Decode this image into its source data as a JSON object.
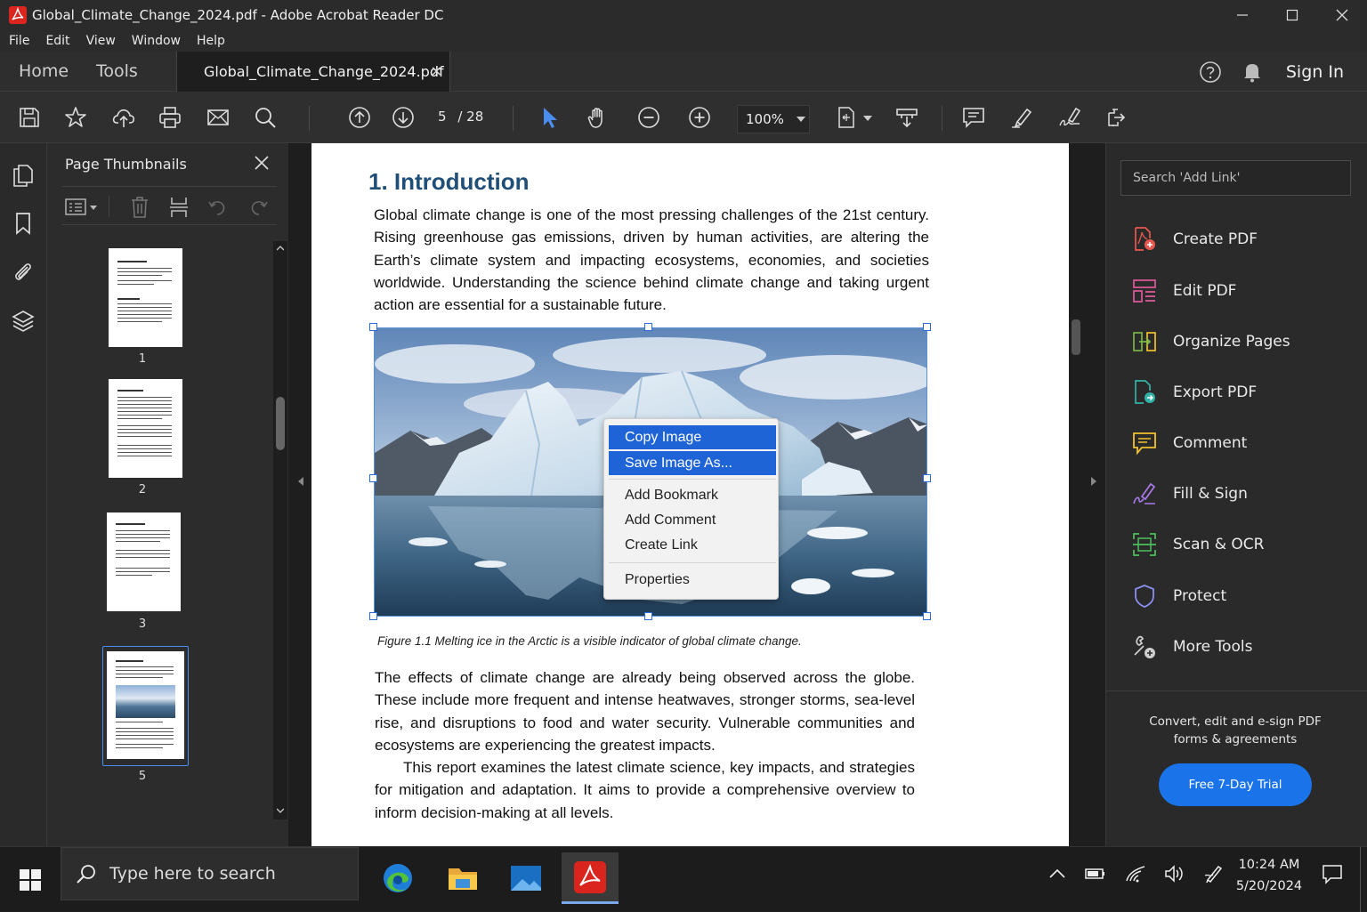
{
  "window": {
    "title": "Global_Climate_Change_2024.pdf - Adobe Acrobat Reader DC",
    "controls": [
      "minimize-icon",
      "maximize-icon",
      "close-icon"
    ]
  },
  "menu": [
    "File",
    "Edit",
    "View",
    "Window",
    "Help"
  ],
  "tabs": {
    "home": "Home",
    "tools": "Tools",
    "document": "Global_Climate_Change_2024.pdf",
    "close_glyph": "×",
    "sign_in": "Sign In"
  },
  "toolbar": {
    "current_page": "5",
    "page_total": "/ 28",
    "zoom": "100%",
    "icons": [
      "save-icon",
      "star-icon",
      "upload-icon",
      "print-icon",
      "email-icon",
      "search-icon",
      "page-up-icon",
      "page-down-icon",
      "select-cursor-icon",
      "hand-icon",
      "zoom-out-icon",
      "zoom-in-icon",
      "page-fit-icon",
      "scroll-mode-icon",
      "comment-icon",
      "highlight-icon",
      "sign-icon",
      "share-icon"
    ]
  },
  "left_rail": [
    "pages-icon",
    "bookmark-icon",
    "attachment-icon",
    "layers-icon"
  ],
  "thumbnails": {
    "title": "Page Thumbnails",
    "pages": [
      "1",
      "2",
      "3",
      "5"
    ],
    "selected_page": "5"
  },
  "document": {
    "heading": "1.  Introduction",
    "para1": "Global climate change is one of the most pressing challenges of the 21st century. Rising greenhouse gas emissions, driven by human activities, are altering the Earth’s climate system and impacting ecosystems, economies, and societies worldwide. Understanding the science behind climate change and taking urgent action are essential for a sustainable future.",
    "caption": "Figure 1.1  Melting ice in the Arctic is a visible indicator of global climate change.",
    "para2": "The effects of climate change are already being observed across the globe. These include more frequent and intense heatwaves, stronger storms, sea-level rise, and disruptions to food and water security. Vulnerable communities and ecosystems are experiencing the greatest impacts.",
    "para3": "This report examines the latest climate science, key impacts, and strategies for mitigation and adaptation. It aims to provide a comprehensive overview to inform decision-making at all levels."
  },
  "context_menu": {
    "items": [
      "Copy Image",
      "Save Image As...",
      "Add Bookmark",
      "Add Comment",
      "Create Link",
      "Properties"
    ],
    "highlighted": [
      "Copy Image",
      "Save Image As..."
    ]
  },
  "right_panel": {
    "search_placeholder": "Search 'Add Link'",
    "tools": [
      {
        "label": "Create PDF",
        "color": "#e8584f"
      },
      {
        "label": "Edit PDF",
        "color": "#e05a9c"
      },
      {
        "label": "Organize Pages",
        "color": "#7ab648"
      },
      {
        "label": "Export PDF",
        "color": "#33b3a6"
      },
      {
        "label": "Comment",
        "color": "#f2c12e"
      },
      {
        "label": "Fill & Sign",
        "color": "#a879e8"
      },
      {
        "label": "Scan & OCR",
        "color": "#4dbf5a"
      },
      {
        "label": "Protect",
        "color": "#8a8ff0"
      },
      {
        "label": "More Tools",
        "color": "#cfcfcf"
      }
    ],
    "promo": "Convert, edit and e-sign PDF forms & agreements",
    "trial_button": "Free 7-Day Trial"
  },
  "taskbar": {
    "search_placeholder": "Type here to search",
    "apps": [
      "edge-icon",
      "file-explorer-icon",
      "photos-icon",
      "acrobat-icon"
    ],
    "time": "10:24 AM",
    "date": "5/20/2024"
  },
  "colors": {
    "accent": "#1f64d6",
    "heading": "#1f4e79",
    "acrobat_red": "#d9251d"
  }
}
